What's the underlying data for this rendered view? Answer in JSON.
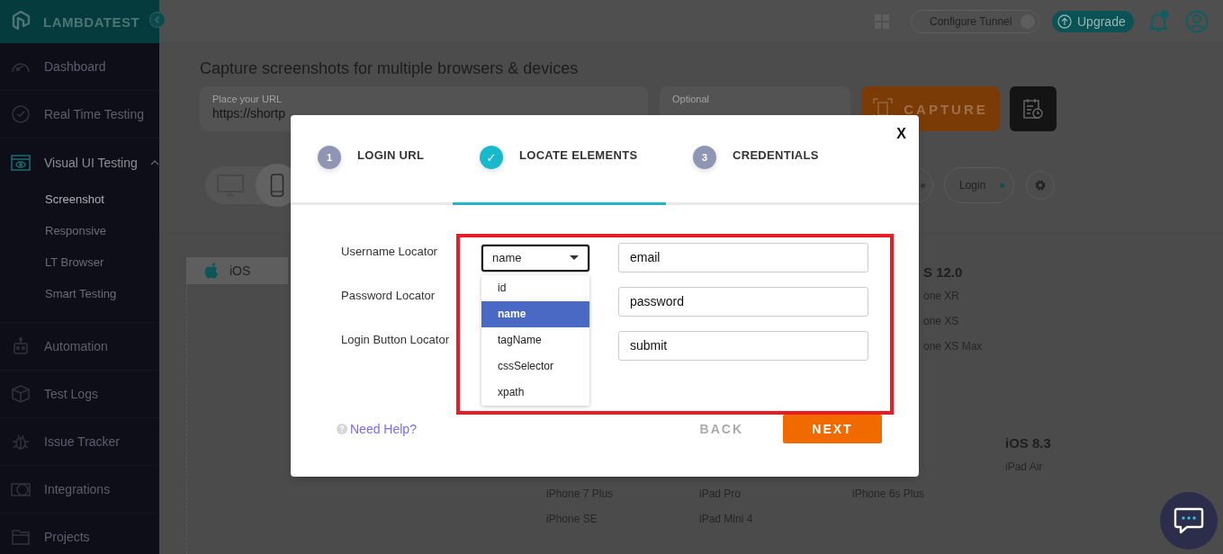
{
  "sidebar": {
    "logo": "LAMBDATEST",
    "items": [
      {
        "label": "Dashboard"
      },
      {
        "label": "Real Time Testing"
      },
      {
        "label": "Visual UI Testing",
        "expanded": true,
        "children": [
          {
            "label": "Screenshot",
            "selected": true
          },
          {
            "label": "Responsive",
            "selected": false
          },
          {
            "label": "LT Browser",
            "selected": false
          },
          {
            "label": "Smart Testing",
            "selected": false
          }
        ]
      },
      {
        "label": "Automation"
      },
      {
        "label": "Test Logs"
      },
      {
        "label": "Issue Tracker"
      },
      {
        "label": "Integrations"
      },
      {
        "label": "Projects"
      }
    ]
  },
  "header": {
    "configure_tunnel": "Configure Tunnel",
    "upgrade": "Upgrade"
  },
  "page": {
    "title": "Capture screenshots for multiple browsers & devices",
    "url_field": {
      "label": "Place your URL",
      "value": "https://shortp"
    },
    "tunnel_field": {
      "label": "Optional"
    },
    "capture_button": "CAPTURE",
    "device_modes": [
      {
        "selected": false
      },
      {
        "selected": true
      }
    ],
    "filters": [
      {
        "label": "Login"
      }
    ],
    "os_tabs": [
      {
        "label": "iOS",
        "selected": true
      }
    ],
    "upper_column": {
      "heading": "S 12.0",
      "devices": [
        "one XR",
        "one XS",
        "one XS Max"
      ]
    },
    "lower_columns": [
      {
        "devices": [
          "iPhone 7 Plus",
          "iPhone SE"
        ]
      },
      {
        "devices": [
          "iPad Pro",
          "iPad Mini 4"
        ]
      },
      {
        "devices": [
          "iPhone 6s Plus"
        ]
      },
      {
        "heading": "iOS 8.3",
        "devices": [
          "iPad Air"
        ]
      }
    ]
  },
  "modal": {
    "close": "X",
    "steps": [
      {
        "badge": "1",
        "label": "LOGIN URL",
        "selected": false
      },
      {
        "badge": "✓",
        "label": "LOCATE ELEMENTS",
        "selected": true
      },
      {
        "badge": "3",
        "label": "CREDENTIALS",
        "selected": false
      }
    ],
    "rows": [
      {
        "label": "Username Locator",
        "locator": "name",
        "value": "email"
      },
      {
        "label": "Password Locator",
        "value": "password"
      },
      {
        "label": "Login Button Locator",
        "value": "submit"
      }
    ],
    "dropdown": {
      "options": [
        {
          "label": "id",
          "selected": false
        },
        {
          "label": "name",
          "selected": true
        },
        {
          "label": "tagName",
          "selected": false
        },
        {
          "label": "cssSelector",
          "selected": false
        },
        {
          "label": "xpath",
          "selected": false
        }
      ]
    },
    "help": "Need Help?",
    "back": "BACK",
    "next": "NEXT"
  }
}
